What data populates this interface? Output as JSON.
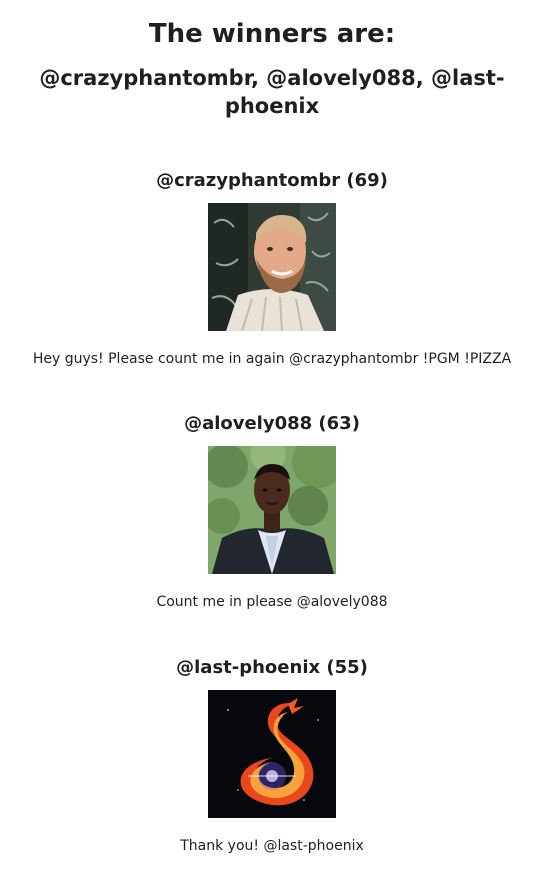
{
  "header": {
    "title": "The winners are:",
    "winners_line": "@crazyphantombr, @alovely088, @last-phoenix"
  },
  "winners": [
    {
      "heading": "@crazyphantombr (69)",
      "avatar_icon": "avatar-photo-bearded-man",
      "comment": "Hey guys! Please count me in again @crazyphantombr !PGM !PIZZA"
    },
    {
      "heading": "@alovely088 (63)",
      "avatar_icon": "avatar-photo-man-in-suit",
      "comment": "Count me in please @alovely088"
    },
    {
      "heading": "@last-phoenix (55)",
      "avatar_icon": "avatar-fire-phoenix",
      "comment": "Thank you! @last-phoenix"
    }
  ]
}
